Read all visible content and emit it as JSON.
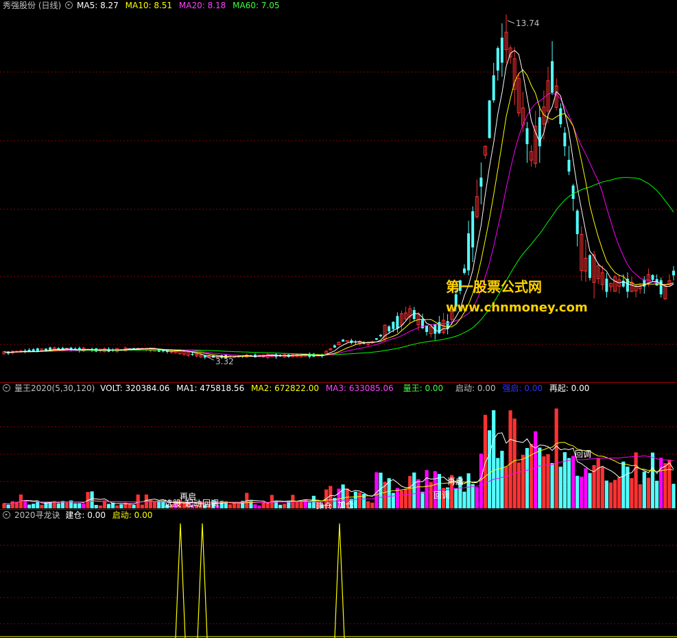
{
  "main_header": {
    "name": "秀强股份 (日线)",
    "ma5": "MA5: 8.27",
    "ma10": "MA10: 8.51",
    "ma20": "MA20: 8.18",
    "ma60": "MA60: 7.05"
  },
  "vol_header": {
    "name": "量王2020(5,30,120)",
    "volt": "VOLT: 320384.06",
    "ma1": "MA1: 475818.56",
    "ma2": "MA2: 672822.00",
    "ma3": "MA3: 633085.06",
    "liangwang": "量王: 0.00",
    "qidong": "启动: 0.00",
    "qiangqi": "强启: 0.00",
    "zaiqi": "再起: 0.00"
  },
  "sig_header": {
    "name": "2020寻龙诀",
    "jiancang": "建仓: 0.00",
    "qidong": "启动: 0.00"
  },
  "watermark": {
    "line1": "第一股票公式网",
    "line2": "www.chnmoney.com"
  },
  "colors": {
    "background": "#000000",
    "up": "#ff3232",
    "down": "#54ffff",
    "ma5": "#ffffff",
    "ma10": "#ffff00",
    "ma20": "#ff00ff",
    "ma60": "#00ff00",
    "grid": "#8b0000",
    "signal": "#ffff00"
  },
  "chart_data": [
    {
      "type": "candlestick",
      "title": "秀强股份 (日线)",
      "ylim": [
        2.5,
        14.5
      ],
      "annotations": {
        "high_label": "13.74",
        "low_label": "3.32"
      },
      "series": [
        {
          "name": "MA5",
          "value": 8.27
        },
        {
          "name": "MA10",
          "value": 8.51
        },
        {
          "name": "MA20",
          "value": 8.18
        },
        {
          "name": "MA60",
          "value": 7.05
        }
      ]
    },
    {
      "type": "bar",
      "title": "量王2020(5,30,120)",
      "series": [
        {
          "name": "VOLT",
          "value": 320384.06
        },
        {
          "name": "MA1",
          "value": 475818.56
        },
        {
          "name": "MA2",
          "value": 672822.0
        },
        {
          "name": "MA3",
          "value": 633085.06
        }
      ],
      "annotations": [
        "再启",
        "选股",
        "起动",
        "回调",
        "建仓",
        "加仓",
        "回调",
        "再启",
        "回调"
      ]
    },
    {
      "type": "line",
      "title": "2020寻龙诀",
      "series": [
        {
          "name": "建仓",
          "value": 0.0
        },
        {
          "name": "启动",
          "value": 0.0
        }
      ]
    }
  ]
}
